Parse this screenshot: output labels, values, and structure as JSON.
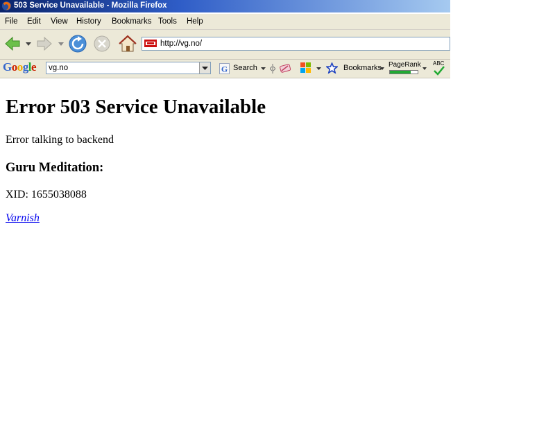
{
  "window": {
    "title": "503 Service Unavailable - Mozilla Firefox"
  },
  "menu": {
    "items": [
      {
        "label": "File"
      },
      {
        "label": "Edit"
      },
      {
        "label": "View"
      },
      {
        "label": "History"
      },
      {
        "label": "Bookmarks"
      },
      {
        "label": "Tools"
      },
      {
        "label": "Help"
      }
    ]
  },
  "navbar": {
    "url": "http://vg.no/"
  },
  "google_toolbar": {
    "logo": [
      "G",
      "o",
      "o",
      "g",
      "l",
      "e"
    ],
    "search_value": "vg.no",
    "search_label": "Search",
    "bookmarks_label": "Bookmarks",
    "pagerank_label": "PageRank",
    "spell_label": "ABC"
  },
  "page": {
    "heading": "Error 503 Service Unavailable",
    "message": "Error talking to backend",
    "subheading": "Guru Meditation:",
    "xid": "XID: 1655038088",
    "link": "Varnish"
  },
  "colors": {
    "titlebar_start": "#0a246a",
    "chrome_bg": "#ece9d8",
    "link": "#0000ee",
    "google_blue": "#3366cc",
    "google_red": "#cc2200",
    "google_yellow": "#eeaa00",
    "google_green": "#22aa33"
  },
  "icons": [
    "firefox-icon",
    "back-icon",
    "forward-icon",
    "reload-icon",
    "stop-icon",
    "home-icon",
    "site-icon",
    "google-g-icon",
    "bookmarks-star-icon",
    "spellcheck-icon"
  ]
}
